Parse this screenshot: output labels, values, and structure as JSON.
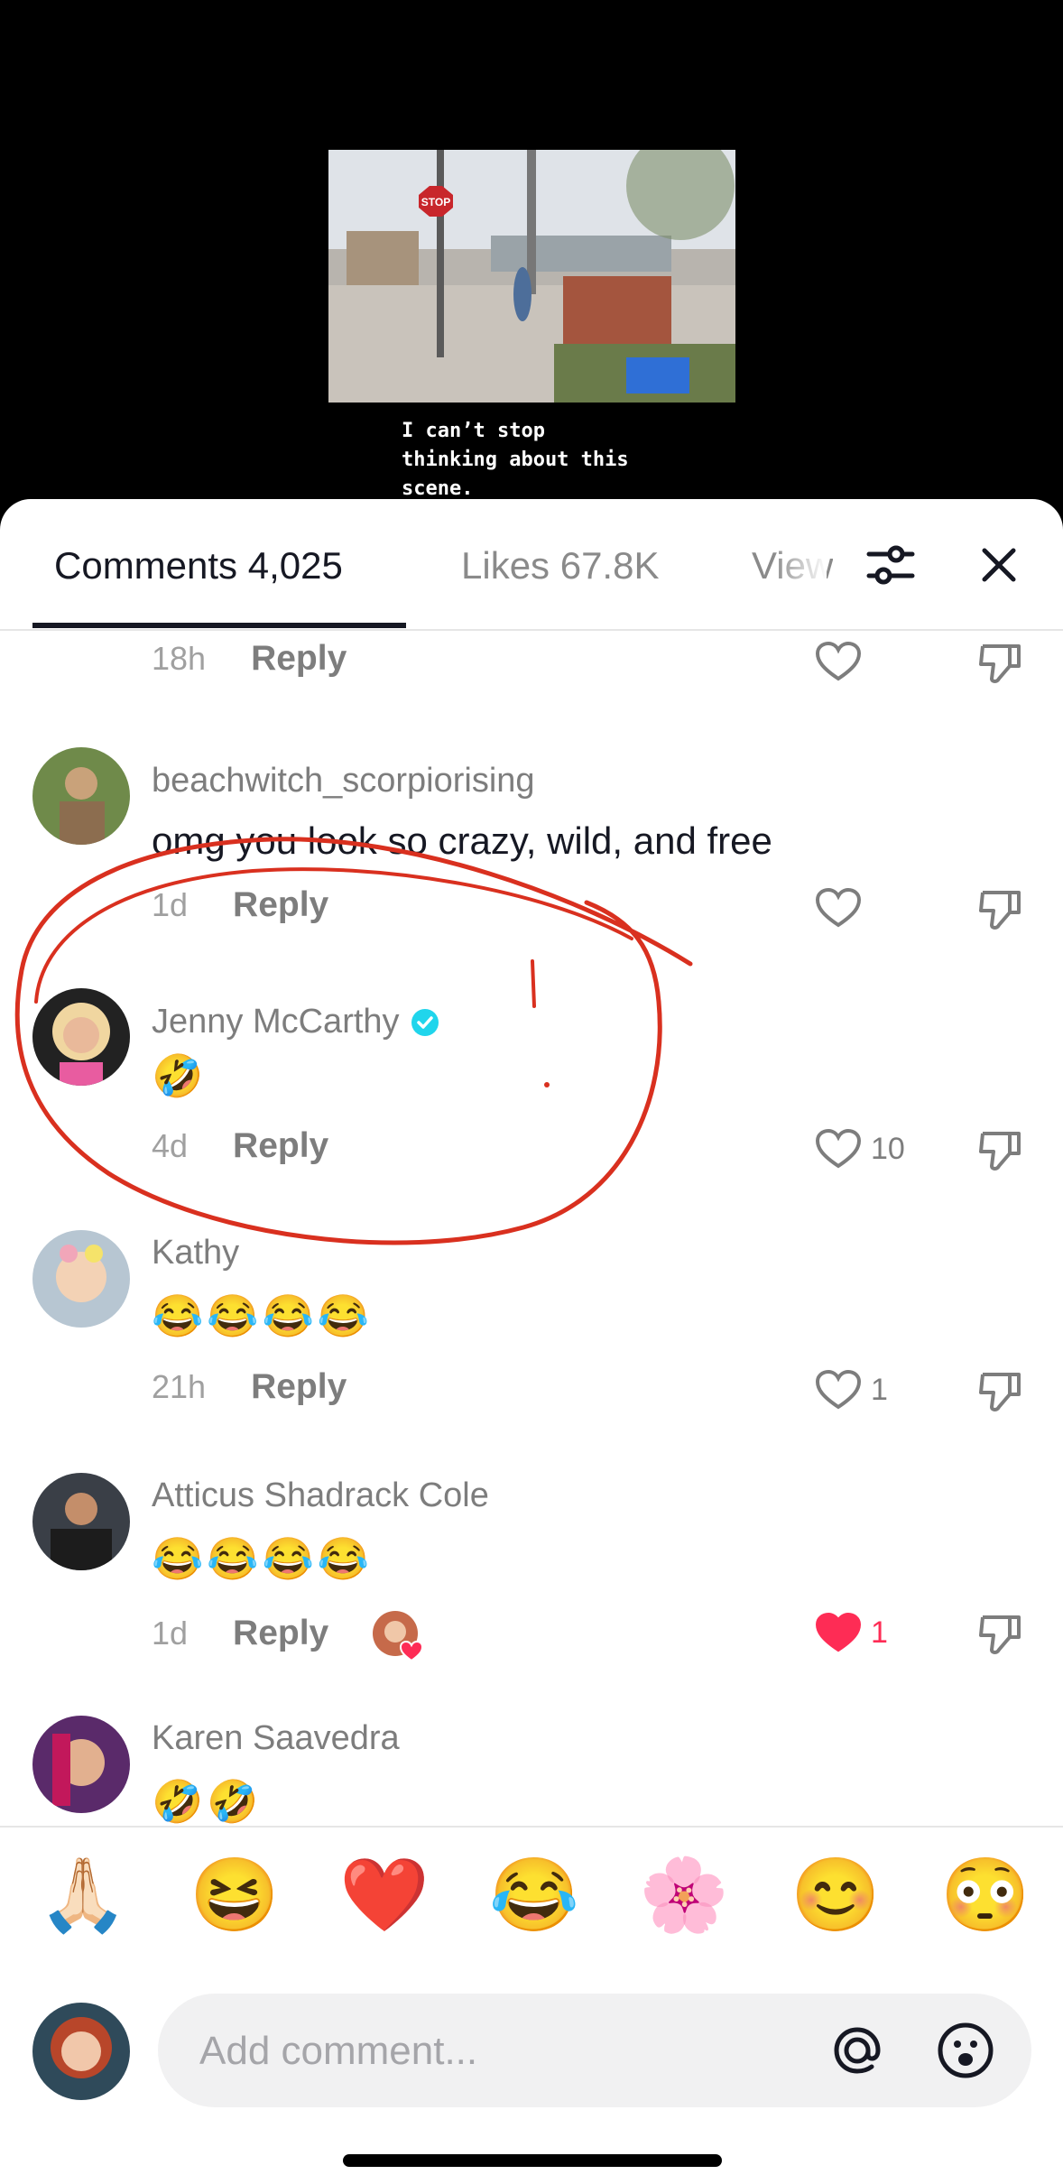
{
  "video": {
    "caption": "I can’t stop\nthinking about this\nscene.",
    "sign_text": "STOP"
  },
  "tabs": [
    {
      "label": "Comments 4,025",
      "active": true
    },
    {
      "label": "Likes 67.8K",
      "active": false
    },
    {
      "label": "Views",
      "active": false
    }
  ],
  "icons": {
    "filter": "sliders-icon",
    "close": "close-icon",
    "like": "heart-icon",
    "dislike": "thumbs-down-icon",
    "verified": "verified-badge-icon",
    "mention": "at-sign-icon",
    "emoji": "emoji-face-icon"
  },
  "comments": [
    {
      "username": "",
      "text": "",
      "time": "18h",
      "reply": "Reply",
      "likes": "",
      "liked": false
    },
    {
      "username": "beachwitch_scorpiorising",
      "text": "omg you look so crazy, wild, and free",
      "time": "1d",
      "reply": "Reply",
      "likes": "",
      "liked": false
    },
    {
      "username": "Jenny McCarthy",
      "verified": true,
      "text": "🤣",
      "time": "4d",
      "reply": "Reply",
      "likes": "10",
      "liked": false
    },
    {
      "username": "Kathy",
      "text": "😂😂😂😂",
      "time": "21h",
      "reply": "Reply",
      "likes": "1",
      "liked": false
    },
    {
      "username": "Atticus Shadrack Cole",
      "text": "😂😂😂😂",
      "time": "1d",
      "reply": "Reply",
      "likes": "1",
      "liked": true,
      "creator_liked": true
    },
    {
      "username": "Karen Saavedra",
      "text": "🤣🤣",
      "time": "",
      "reply": "",
      "likes": "",
      "liked": false
    }
  ],
  "quick_emojis": [
    "🙏🏻",
    "😆",
    "❤️",
    "😂",
    "🌸",
    "😊",
    "😳"
  ],
  "composer": {
    "placeholder": "Add comment..."
  },
  "colors": {
    "accent_red": "#fe2c55",
    "verified": "#20d5ec",
    "annotation": "#d9301f"
  }
}
